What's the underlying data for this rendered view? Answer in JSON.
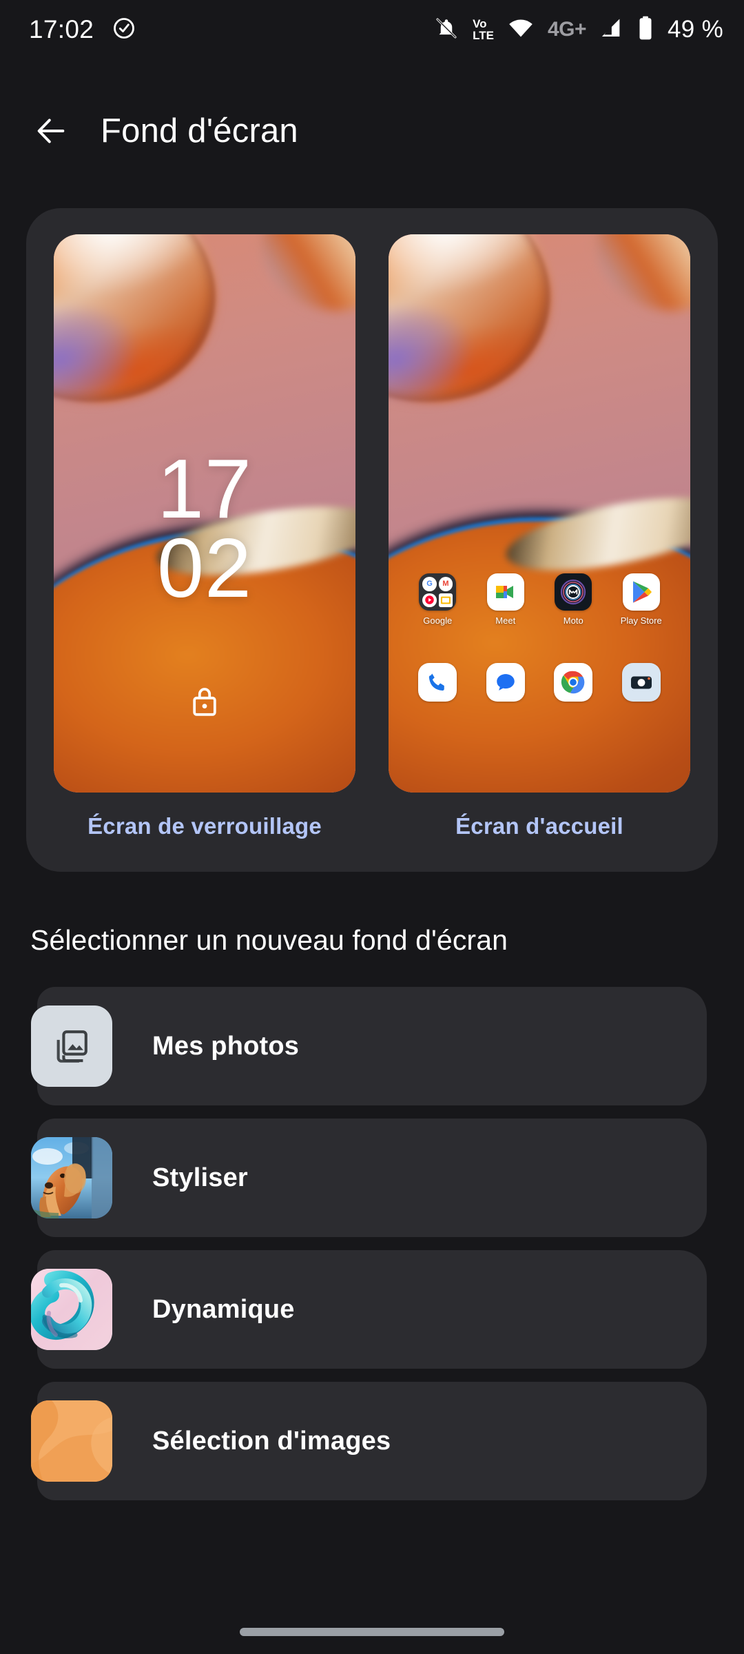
{
  "status_bar": {
    "time": "17:02",
    "left_icons": [
      {
        "name": "check-circle-icon"
      }
    ],
    "right_icons": [
      {
        "name": "notifications-muted-icon"
      },
      {
        "name": "volte-icon",
        "line1": "Vo",
        "line2": "LTE"
      },
      {
        "name": "wifi-icon"
      },
      {
        "name": "network-type-label",
        "label": "4G+"
      },
      {
        "name": "cellular-signal-icon"
      },
      {
        "name": "battery-icon"
      }
    ],
    "battery_percent": "49 %"
  },
  "header": {
    "title": "Fond d'écran",
    "back_label": "Retour"
  },
  "preview": {
    "lock_screen": {
      "tab_label": "Écran de verrouillage",
      "clock_hours": "17",
      "clock_minutes": "02",
      "lock_icon": "lock-icon"
    },
    "home_screen": {
      "tab_label": "Écran d'accueil",
      "apps": [
        {
          "label": "Google",
          "icon": "google-folder-icon"
        },
        {
          "label": "Meet",
          "icon": "google-meet-icon"
        },
        {
          "label": "Moto",
          "icon": "moto-icon"
        },
        {
          "label": "Play Store",
          "icon": "play-store-icon"
        }
      ],
      "dock": [
        {
          "label": "Phone",
          "icon": "phone-icon"
        },
        {
          "label": "Messages",
          "icon": "messages-icon"
        },
        {
          "label": "Chrome",
          "icon": "chrome-icon"
        },
        {
          "label": "Camera",
          "icon": "camera-icon"
        }
      ]
    }
  },
  "section": {
    "title": "Sélectionner un nouveau fond d'écran"
  },
  "options": [
    {
      "label": "Mes photos",
      "thumb": "photo-library-icon",
      "thumb_kind": "photos"
    },
    {
      "label": "Styliser",
      "thumb": "dog-photo-thumbnail",
      "thumb_kind": "styliser"
    },
    {
      "label": "Dynamique",
      "thumb": "abstract-3d-thumbnail",
      "thumb_kind": "dynamique"
    },
    {
      "label": "Sélection d'images",
      "thumb": "orange-gradient-thumbnail",
      "thumb_kind": "selection"
    }
  ],
  "nav": {
    "pill": "gesture-home-pill"
  },
  "colors": {
    "background": "#17171a",
    "card": "#2a2a2e",
    "list_item": "#2c2c30",
    "accent_tab": "#b3c5f7",
    "text_primary": "#ffffff",
    "nav_pill": "#9ba0a6"
  }
}
